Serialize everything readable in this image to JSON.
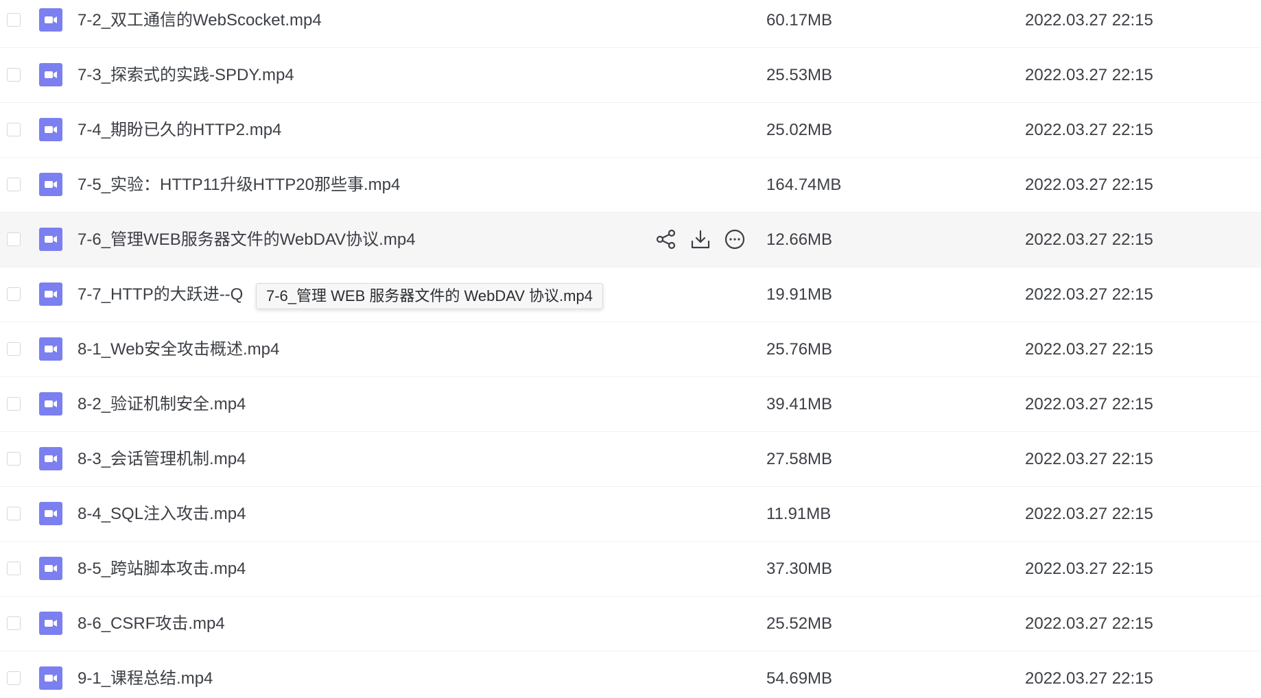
{
  "files": [
    {
      "name": "7-2_双工通信的WebScocket.mp4",
      "size": "60.17MB",
      "date": "2022.03.27 22:15"
    },
    {
      "name": "7-3_探索式的实践-SPDY.mp4",
      "size": "25.53MB",
      "date": "2022.03.27 22:15"
    },
    {
      "name": "7-4_期盼已久的HTTP2.mp4",
      "size": "25.02MB",
      "date": "2022.03.27 22:15"
    },
    {
      "name": "7-5_实验：HTTP11升级HTTP20那些事.mp4",
      "size": "164.74MB",
      "date": "2022.03.27 22:15"
    },
    {
      "name": "7-6_管理WEB服务器文件的WebDAV协议.mp4",
      "size": "12.66MB",
      "date": "2022.03.27 22:15"
    },
    {
      "name": "7-7_HTTP的大跃进--Q",
      "size": "19.91MB",
      "date": "2022.03.27 22:15"
    },
    {
      "name": "8-1_Web安全攻击概述.mp4",
      "size": "25.76MB",
      "date": "2022.03.27 22:15"
    },
    {
      "name": "8-2_验证机制安全.mp4",
      "size": "39.41MB",
      "date": "2022.03.27 22:15"
    },
    {
      "name": "8-3_会话管理机制.mp4",
      "size": "27.58MB",
      "date": "2022.03.27 22:15"
    },
    {
      "name": "8-4_SQL注入攻击.mp4",
      "size": "11.91MB",
      "date": "2022.03.27 22:15"
    },
    {
      "name": "8-5_跨站脚本攻击.mp4",
      "size": "37.30MB",
      "date": "2022.03.27 22:15"
    },
    {
      "name": "8-6_CSRF攻击.mp4",
      "size": "25.52MB",
      "date": "2022.03.27 22:15"
    },
    {
      "name": "9-1_课程总结.mp4",
      "size": "54.69MB",
      "date": "2022.03.27 22:15"
    }
  ],
  "hovered_row": 4,
  "row_actions": [
    "share-icon",
    "download-icon",
    "more-icon"
  ],
  "tooltip": {
    "text": "7-6_管理 WEB 服务器文件的 WebDAV 协议.mp4"
  },
  "colors": {
    "video_icon": "#7b7ff0",
    "hover_row": "#f6f6f7",
    "text": "#3c3f45"
  }
}
